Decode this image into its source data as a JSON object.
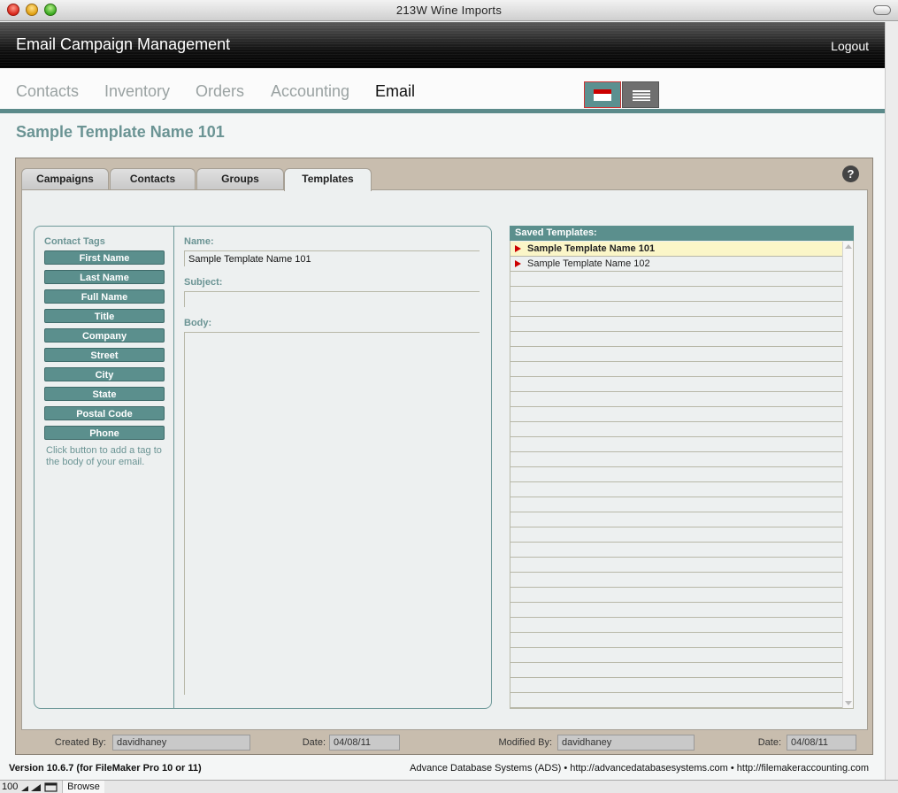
{
  "window": {
    "title": "213W Wine Imports"
  },
  "header": {
    "title": "Email Campaign Management",
    "logout_label": "Logout"
  },
  "nav": {
    "items": [
      {
        "label": "Contacts"
      },
      {
        "label": "Inventory"
      },
      {
        "label": "Orders"
      },
      {
        "label": "Accounting"
      },
      {
        "label": "Email",
        "active": true
      }
    ]
  },
  "page": {
    "title": "Sample Template Name 101"
  },
  "tabs": [
    {
      "label": "Campaigns"
    },
    {
      "label": "Contacts"
    },
    {
      "label": "Groups"
    },
    {
      "label": "Templates",
      "active": true
    }
  ],
  "help": {
    "label": "?"
  },
  "contact_tags": {
    "label": "Contact Tags",
    "buttons": [
      "First Name",
      "Last Name",
      "Full Name",
      "Title",
      "Company",
      "Street",
      "City",
      "State",
      "Postal Code",
      "Phone"
    ],
    "hint": "Click button to add a tag to the body of your email."
  },
  "form": {
    "name_label": "Name:",
    "name_value": "Sample Template Name 101",
    "subject_label": "Subject:",
    "subject_value": "",
    "body_label": "Body:",
    "body_value": ""
  },
  "saved_templates": {
    "header": "Saved Templates:",
    "rows": [
      "Sample Template Name 101",
      "Sample Template Name 102"
    ],
    "selected_index": 0
  },
  "record_info": {
    "created_by_label": "Created By:",
    "created_by_value": "davidhaney",
    "created_date_label": "Date:",
    "created_date_value": "04/08/11",
    "modified_by_label": "Modified By:",
    "modified_by_value": "davidhaney",
    "modified_date_label": "Date:",
    "modified_date_value": "04/08/11"
  },
  "footer": {
    "version": "Version 10.6.7 (for FileMaker Pro 10 or 11)",
    "credits": "Advance Database Systems (ADS) • http://advancedatabasesystems.com • http://filemakeraccounting.com"
  },
  "statusbar": {
    "zoom": "100",
    "mode": "Browse"
  },
  "colors": {
    "accent": "#5b8f8d",
    "header_dark": "#111111",
    "selected_row": "#fbf6c8",
    "pointer_arrow": "#cc0000"
  }
}
